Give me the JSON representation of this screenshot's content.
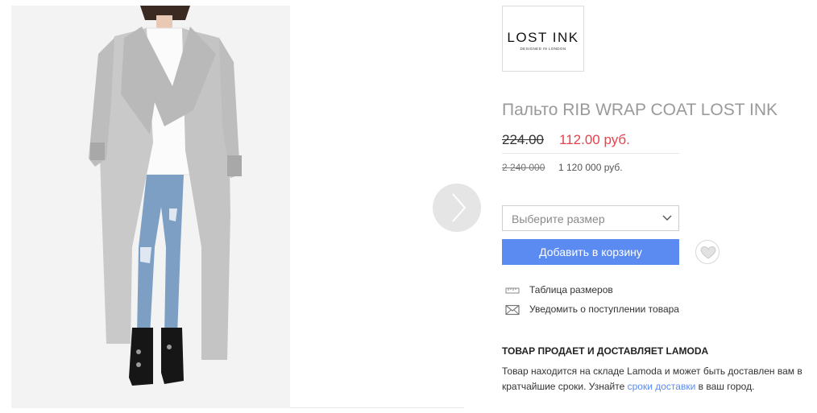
{
  "brand": {
    "name": "LOST INK",
    "tagline": "DESIGNED IN LONDON"
  },
  "product": {
    "title": "Пальто RIB WRAP COAT LOST INK",
    "price_old": "224.00",
    "price_new": "112.00 руб.",
    "price_old_alt": "2 240 000",
    "price_new_alt": "1 120 000 руб."
  },
  "size_select": {
    "placeholder": "Выберите размер"
  },
  "actions": {
    "add_to_cart": "Добавить в корзину"
  },
  "links": {
    "size_table": "Таблица размеров",
    "notify": "Уведомить о поступлении товара"
  },
  "seller": {
    "heading": "ТОВАР ПРОДАЕТ И ДОСТАВЛЯЕТ LAMODA",
    "text_part1": "Товар находится на складе Lamoda и может быть доставлен вам в кратчайшие сроки. Узнайте ",
    "link_text": "сроки доставки",
    "text_part2": " в ваш город."
  },
  "colors": {
    "accent": "#5b8bf0",
    "sale": "#e8414a",
    "title_grey": "#9a9a9a"
  },
  "icons": {
    "next": "chevron-right-icon",
    "wishlist": "heart-icon",
    "size_table": "ruler-icon",
    "notify": "envelope-icon",
    "dropdown": "chevron-down-icon"
  }
}
